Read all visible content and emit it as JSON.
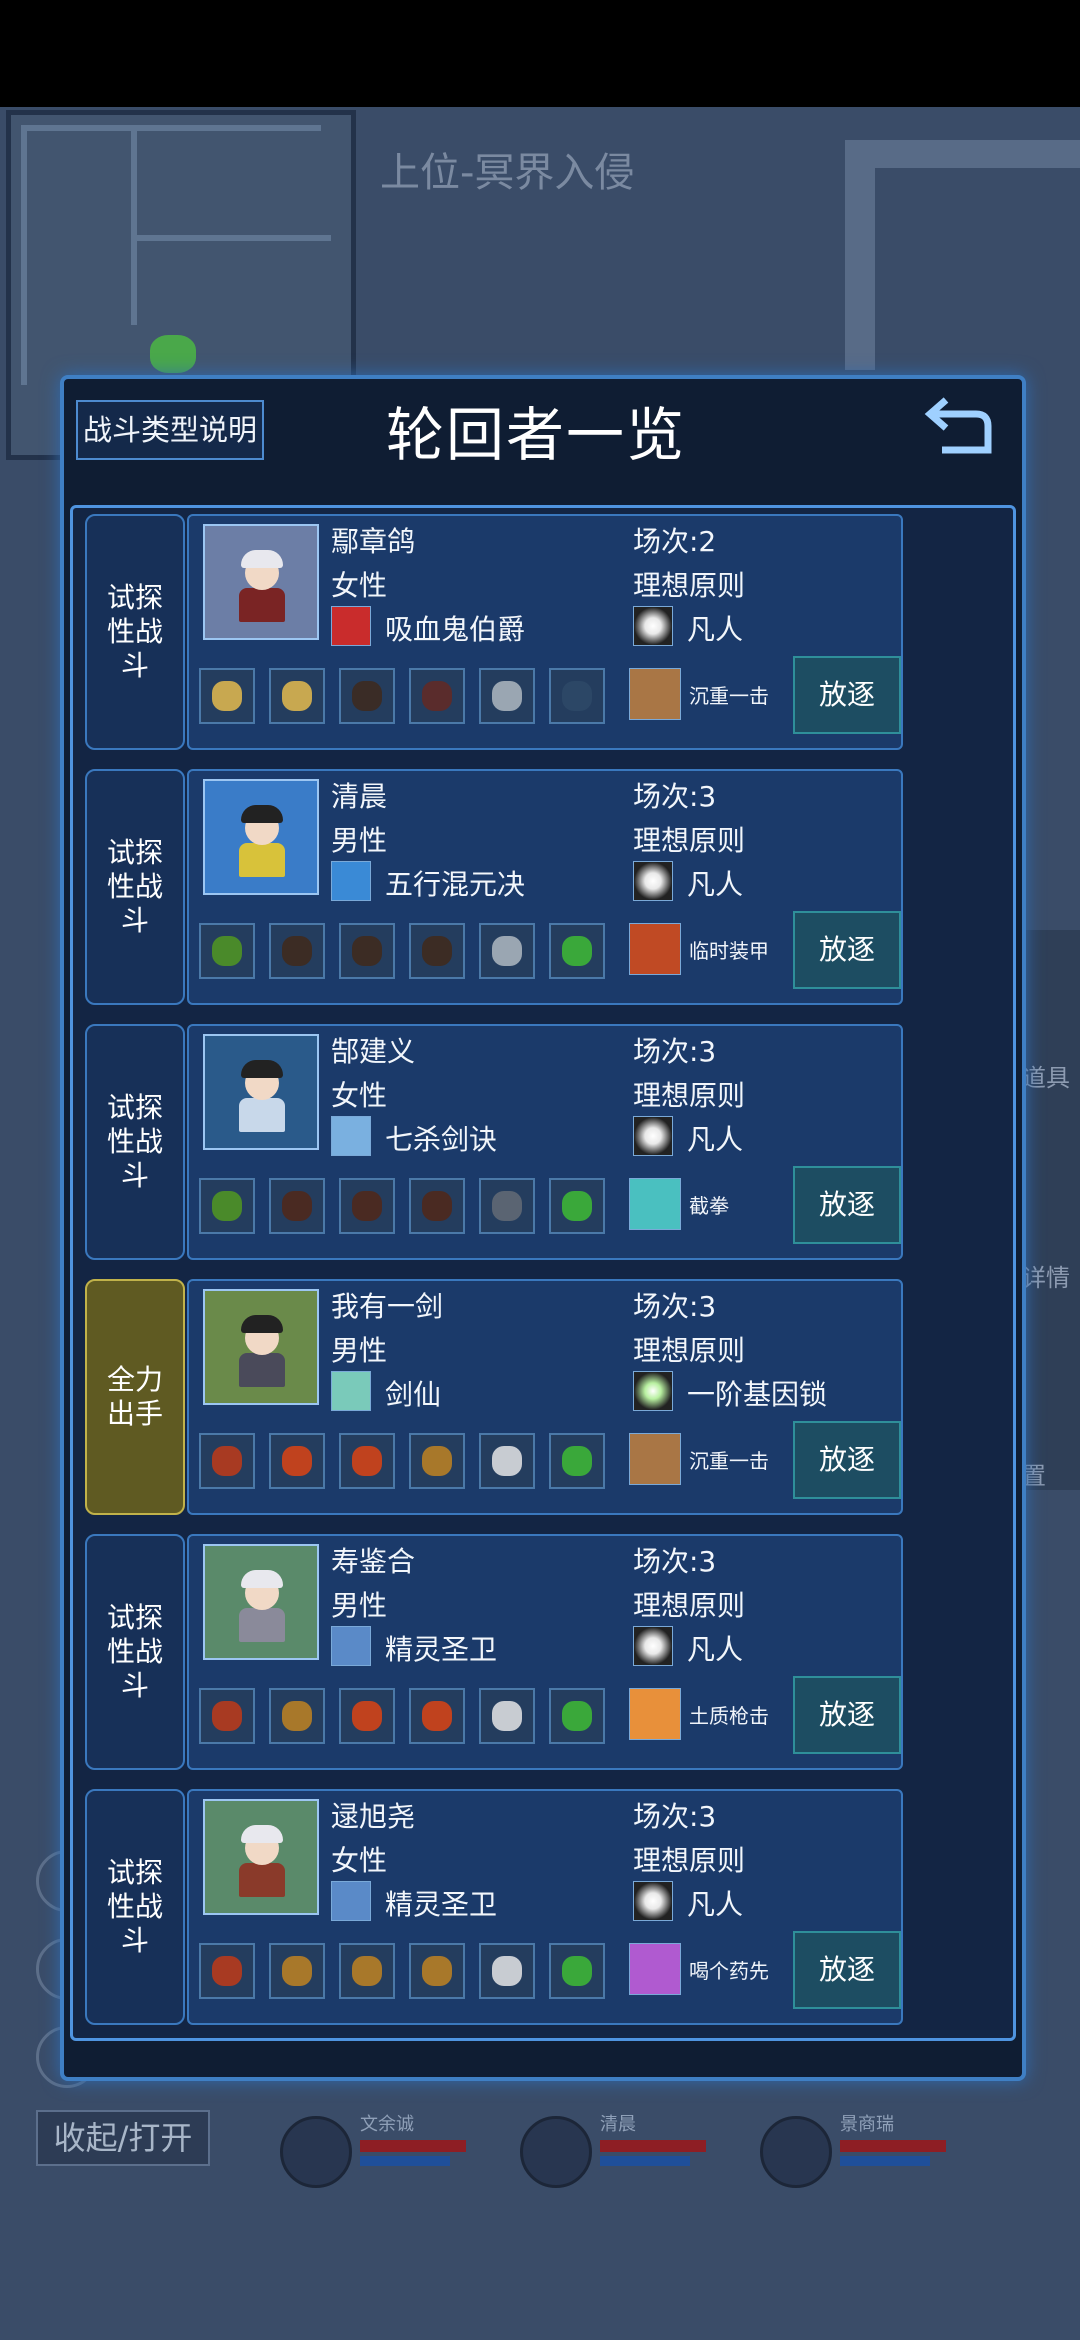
{
  "map_title": "上位-冥界入侵",
  "side_menu": {
    "items_label": "道具",
    "details_label": "详情",
    "settings_label": "置"
  },
  "collapse_label": "收起/打开",
  "party": [
    {
      "name": "文余诚"
    },
    {
      "name": "清晨"
    },
    {
      "name": "景商瑞"
    }
  ],
  "dialog": {
    "battle_type_button": "战斗类型说明",
    "title": "轮回者一览",
    "back_icon": "back-arrow-icon"
  },
  "entries": [
    {
      "tag": "试探性战斗",
      "tag_lines": [
        "试探",
        "性战",
        "斗"
      ],
      "name": "鄢章鸽",
      "gender": "女性",
      "bloodline": "吸血鬼伯爵",
      "rounds": "场次:2",
      "principle": "理想原则",
      "gene": "凡人",
      "skill": "沉重一击",
      "expel": "放逐",
      "colors": {
        "bg": "#6c7ea6",
        "hair": "#e8e8ee",
        "body": "#7a2424",
        "blood": "#c92c2c",
        "gene": "#e9e9e9",
        "skill": "#a97645"
      },
      "items": [
        "#c8a850",
        "#c8a850",
        "#3a2c26",
        "#5a2c2c",
        "#9aa6b2",
        "#2c4766"
      ]
    },
    {
      "tag": "试探性战斗",
      "tag_lines": [
        "试探",
        "性战",
        "斗"
      ],
      "name": "清晨",
      "gender": "男性",
      "bloodline": "五行混元决",
      "rounds": "场次:3",
      "principle": "理想原则",
      "gene": "凡人",
      "skill": "临时装甲",
      "expel": "放逐",
      "colors": {
        "bg": "#3a7cc8",
        "hair": "#222222",
        "body": "#d8c23a",
        "blood": "#3a8ad6",
        "gene": "#e9e9e9",
        "skill": "#c04a24"
      },
      "items": [
        "#4a8a2a",
        "#3c2c24",
        "#3c2c24",
        "#3c2c24",
        "#9aa6b2",
        "#3aa83a"
      ]
    },
    {
      "tag": "试探性战斗",
      "tag_lines": [
        "试探",
        "性战",
        "斗"
      ],
      "name": "郜建义",
      "gender": "女性",
      "bloodline": "七杀剑诀",
      "rounds": "场次:3",
      "principle": "理想原则",
      "gene": "凡人",
      "skill": "截拳",
      "expel": "放逐",
      "colors": {
        "bg": "#2a5a8a",
        "hair": "#222222",
        "body": "#c8d8ea",
        "blood": "#7ab0e0",
        "gene": "#e9e9e9",
        "skill": "#4ac0c0"
      },
      "items": [
        "#4a8a2a",
        "#4a2a22",
        "#4a2a22",
        "#4a2a22",
        "#5a6472",
        "#3aa83a"
      ]
    },
    {
      "tag": "全力出手",
      "tag_lines": [
        "全力",
        "出手"
      ],
      "name": "我有一剑",
      "gender": "男性",
      "bloodline": "剑仙",
      "rounds": "场次:3",
      "principle": "理想原则",
      "gene": "一阶基因锁",
      "skill": "沉重一击",
      "expel": "放逐",
      "colors": {
        "bg": "#6a8a4a",
        "hair": "#222222",
        "body": "#4a4a5a",
        "blood": "#7acaba",
        "gene": "#b8f0a0",
        "skill": "#a97645"
      },
      "items": [
        "#a83a22",
        "#c0421e",
        "#c0421e",
        "#a8782a",
        "#c8ccd2",
        "#3aa83a"
      ]
    },
    {
      "tag": "试探性战斗",
      "tag_lines": [
        "试探",
        "性战",
        "斗"
      ],
      "name": "寿鉴合",
      "gender": "男性",
      "bloodline": "精灵圣卫",
      "rounds": "场次:3",
      "principle": "理想原则",
      "gene": "凡人",
      "skill": "土质枪击",
      "expel": "放逐",
      "colors": {
        "bg": "#5a8a6a",
        "hair": "#e8e8ee",
        "body": "#8a8a9a",
        "blood": "#5a8ac8",
        "gene": "#e9e9e9",
        "skill": "#e8903a"
      },
      "items": [
        "#a83a22",
        "#a8782a",
        "#c0421e",
        "#c0421e",
        "#c8ccd2",
        "#3aa83a"
      ]
    },
    {
      "tag": "试探性战斗",
      "tag_lines": [
        "试探",
        "性战",
        "斗"
      ],
      "name": "逯旭尧",
      "gender": "女性",
      "bloodline": "精灵圣卫",
      "rounds": "场次:3",
      "principle": "理想原则",
      "gene": "凡人",
      "skill": "喝个药先",
      "expel": "放逐",
      "colors": {
        "bg": "#5a8a6a",
        "hair": "#e8e8ee",
        "body": "#8a3a2a",
        "blood": "#5a8ac8",
        "gene": "#e9e9e9",
        "skill": "#b05ad0"
      },
      "items": [
        "#a83a22",
        "#a8782a",
        "#a8782a",
        "#a8782a",
        "#c8ccd2",
        "#3aa83a"
      ]
    }
  ]
}
